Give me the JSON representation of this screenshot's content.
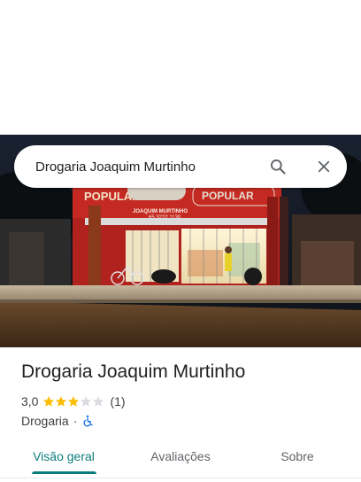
{
  "search": {
    "value": "Drogaria Joaquim Murtinho",
    "search_icon": "search-icon",
    "close_icon": "close-icon"
  },
  "photo": {
    "storefront_sign_left": "POPULAR",
    "storefront_sign_right": "POPULAR",
    "storefront_sign_brand": "JOAQUIM MURTINHO",
    "storefront_phone": "65 3222 1130"
  },
  "place": {
    "name": "Drogaria Joaquim Murtinho",
    "rating": "3,0",
    "rating_value": 3,
    "rating_max": 5,
    "review_count": "(1)",
    "category": "Drogaria",
    "separator": "·",
    "accessibility_icon": "wheelchair-icon"
  },
  "tabs": [
    {
      "label": "Visão geral",
      "active": true
    },
    {
      "label": "Avaliações",
      "active": false
    },
    {
      "label": "Sobre",
      "active": false
    }
  ],
  "colors": {
    "accent": "#0b7c7c",
    "star": "#fbbc04",
    "star_empty": "#dadce0",
    "accessibility": "#1a73e8"
  }
}
